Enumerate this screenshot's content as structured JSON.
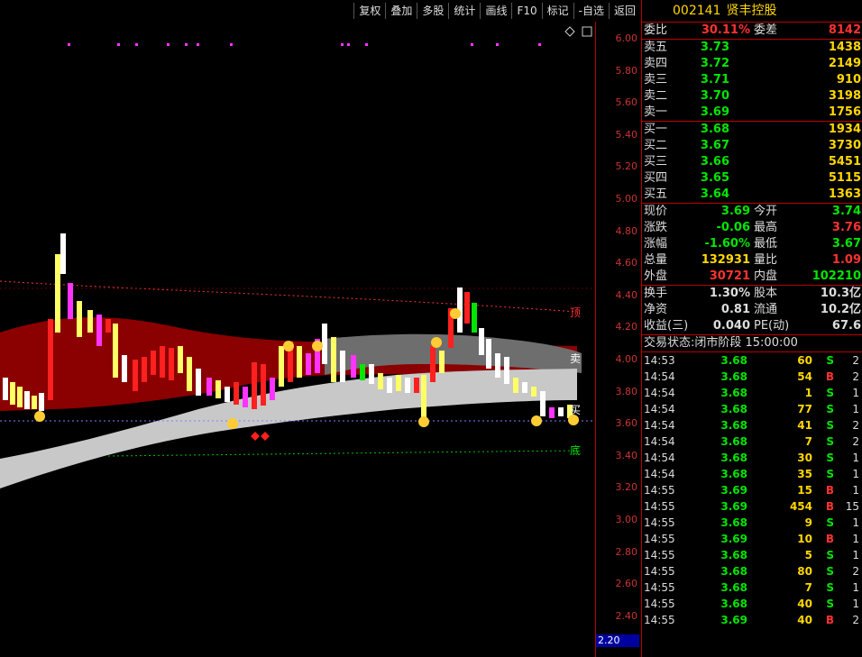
{
  "toolbar": [
    "复权",
    "叠加",
    "多股",
    "统计",
    "画线",
    "F10",
    "标记",
    "-自选",
    "返回"
  ],
  "stock": {
    "code": "002141",
    "name": "贤丰控股"
  },
  "axis": {
    "ticks": [
      "6.00",
      "5.80",
      "5.60",
      "5.40",
      "5.20",
      "5.00",
      "4.80",
      "4.60",
      "4.40",
      "4.20",
      "4.00",
      "3.80",
      "3.60",
      "3.40",
      "3.20",
      "3.00",
      "2.80",
      "2.60",
      "2.40"
    ],
    "current": "2.20"
  },
  "chart_labels": {
    "top": "顶",
    "sell": "卖",
    "buy": "买",
    "bottom": "底"
  },
  "order_ratio": {
    "label": "委比",
    "value": "30.11%",
    "label2": "委差",
    "value2": "8142"
  },
  "asks": [
    {
      "label": "卖五",
      "price": "3.73",
      "vol": "1438"
    },
    {
      "label": "卖四",
      "price": "3.72",
      "vol": "2149"
    },
    {
      "label": "卖三",
      "price": "3.71",
      "vol": "910"
    },
    {
      "label": "卖二",
      "price": "3.70",
      "vol": "3198"
    },
    {
      "label": "卖一",
      "price": "3.69",
      "vol": "1756"
    }
  ],
  "bids": [
    {
      "label": "买一",
      "price": "3.68",
      "vol": "1934"
    },
    {
      "label": "买二",
      "price": "3.67",
      "vol": "3730"
    },
    {
      "label": "买三",
      "price": "3.66",
      "vol": "5451"
    },
    {
      "label": "买四",
      "price": "3.65",
      "vol": "5115"
    },
    {
      "label": "买五",
      "price": "3.64",
      "vol": "1363"
    }
  ],
  "quote": [
    {
      "l1": "现价",
      "v1": "3.69",
      "c1": "green",
      "l2": "今开",
      "v2": "3.74",
      "c2": "green"
    },
    {
      "l1": "涨跌",
      "v1": "-0.06",
      "c1": "green",
      "l2": "最高",
      "v2": "3.76",
      "c2": "red"
    },
    {
      "l1": "涨幅",
      "v1": "-1.60%",
      "c1": "green",
      "l2": "最低",
      "v2": "3.67",
      "c2": "green"
    },
    {
      "l1": "总量",
      "v1": "132931",
      "c1": "yellow",
      "l2": "量比",
      "v2": "1.09",
      "c2": "red"
    },
    {
      "l1": "外盘",
      "v1": "30721",
      "c1": "red",
      "l2": "内盘",
      "v2": "102210",
      "c2": "green"
    }
  ],
  "fund": [
    {
      "l1": "换手",
      "v1": "1.30%",
      "l2": "股本",
      "v2": "10.3亿"
    },
    {
      "l1": "净资",
      "v1": "0.81",
      "l2": "流通",
      "v2": "10.2亿"
    },
    {
      "l1": "收益(三)",
      "v1": "0.040",
      "l2": "PE(动)",
      "v2": "67.6"
    }
  ],
  "status": "交易状态:闭市阶段 15:00:00",
  "ticks": [
    {
      "t": "14:53",
      "p": "3.68",
      "v": "60",
      "bs": "S",
      "n": "2"
    },
    {
      "t": "14:54",
      "p": "3.68",
      "v": "54",
      "bs": "B",
      "n": "2"
    },
    {
      "t": "14:54",
      "p": "3.68",
      "v": "1",
      "bs": "S",
      "n": "1"
    },
    {
      "t": "14:54",
      "p": "3.68",
      "v": "77",
      "bs": "S",
      "n": "1"
    },
    {
      "t": "14:54",
      "p": "3.68",
      "v": "41",
      "bs": "S",
      "n": "2"
    },
    {
      "t": "14:54",
      "p": "3.68",
      "v": "7",
      "bs": "S",
      "n": "2"
    },
    {
      "t": "14:54",
      "p": "3.68",
      "v": "30",
      "bs": "S",
      "n": "1"
    },
    {
      "t": "14:54",
      "p": "3.68",
      "v": "35",
      "bs": "S",
      "n": "1"
    },
    {
      "t": "14:55",
      "p": "3.69",
      "v": "15",
      "bs": "B",
      "n": "1"
    },
    {
      "t": "14:55",
      "p": "3.69",
      "v": "454",
      "bs": "B",
      "n": "15"
    },
    {
      "t": "14:55",
      "p": "3.68",
      "v": "9",
      "bs": "S",
      "n": "1"
    },
    {
      "t": "14:55",
      "p": "3.69",
      "v": "10",
      "bs": "B",
      "n": "1"
    },
    {
      "t": "14:55",
      "p": "3.68",
      "v": "5",
      "bs": "S",
      "n": "1"
    },
    {
      "t": "14:55",
      "p": "3.68",
      "v": "80",
      "bs": "S",
      "n": "2"
    },
    {
      "t": "14:55",
      "p": "3.68",
      "v": "7",
      "bs": "S",
      "n": "1"
    },
    {
      "t": "14:55",
      "p": "3.68",
      "v": "40",
      "bs": "S",
      "n": "1"
    },
    {
      "t": "14:55",
      "p": "3.69",
      "v": "40",
      "bs": "B",
      "n": "2"
    }
  ],
  "colors": {
    "up": "#ff3232",
    "down": "#00e600",
    "band": "#8b0000",
    "band_light": "#c8c8c8",
    "band_dark": "#6e6e6e"
  }
}
